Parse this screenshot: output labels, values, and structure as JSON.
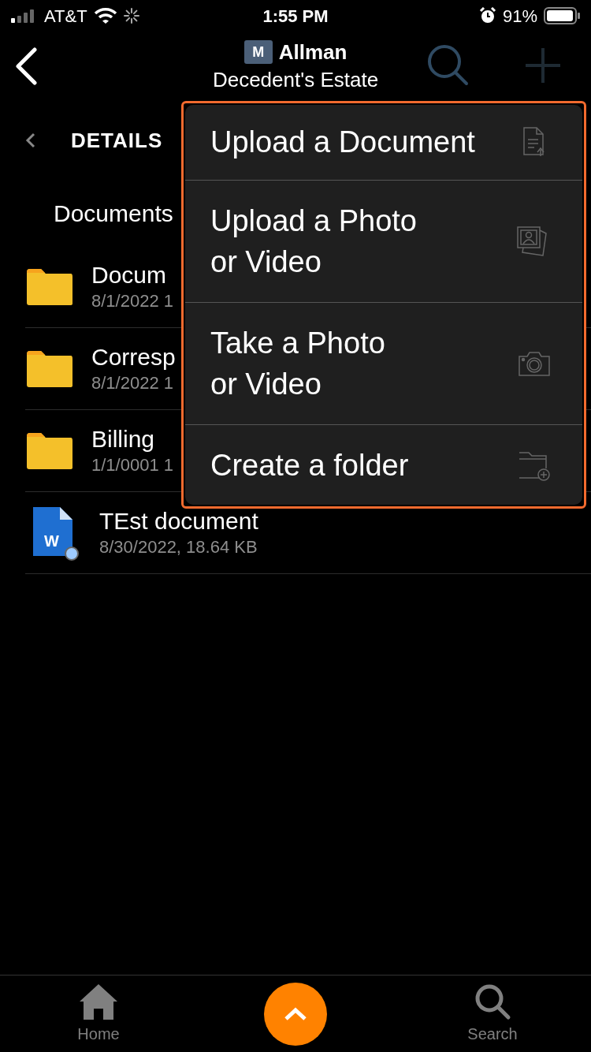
{
  "status_bar": {
    "carrier": "AT&T",
    "time": "1:55 PM",
    "battery": "91%"
  },
  "header": {
    "logo_letter": "M",
    "title": "Allman",
    "subtitle": "Decedent's Estate"
  },
  "section": {
    "label": "DETAILS"
  },
  "group": {
    "label": "Documents"
  },
  "files": [
    {
      "kind": "folder",
      "name": "Docum",
      "meta": "8/1/2022 1"
    },
    {
      "kind": "folder",
      "name": "Corresp",
      "meta": "8/1/2022 1"
    },
    {
      "kind": "folder",
      "name": "Billing",
      "meta": "1/1/0001 1"
    },
    {
      "kind": "word",
      "name": "TEst document",
      "meta": "8/30/2022, 18.64 KB",
      "badge_letter": "W"
    }
  ],
  "menu": [
    {
      "kind": "upload-document",
      "label": "Upload a Document"
    },
    {
      "kind": "upload-photo",
      "label": "Upload a Photo\nor Video"
    },
    {
      "kind": "camera",
      "label": "Take a Photo\nor Video"
    },
    {
      "kind": "new-folder",
      "label": "Create a folder"
    }
  ],
  "tabs": [
    {
      "kind": "home",
      "label": "Home"
    },
    {
      "kind": "fab"
    },
    {
      "kind": "search",
      "label": "Search"
    }
  ]
}
